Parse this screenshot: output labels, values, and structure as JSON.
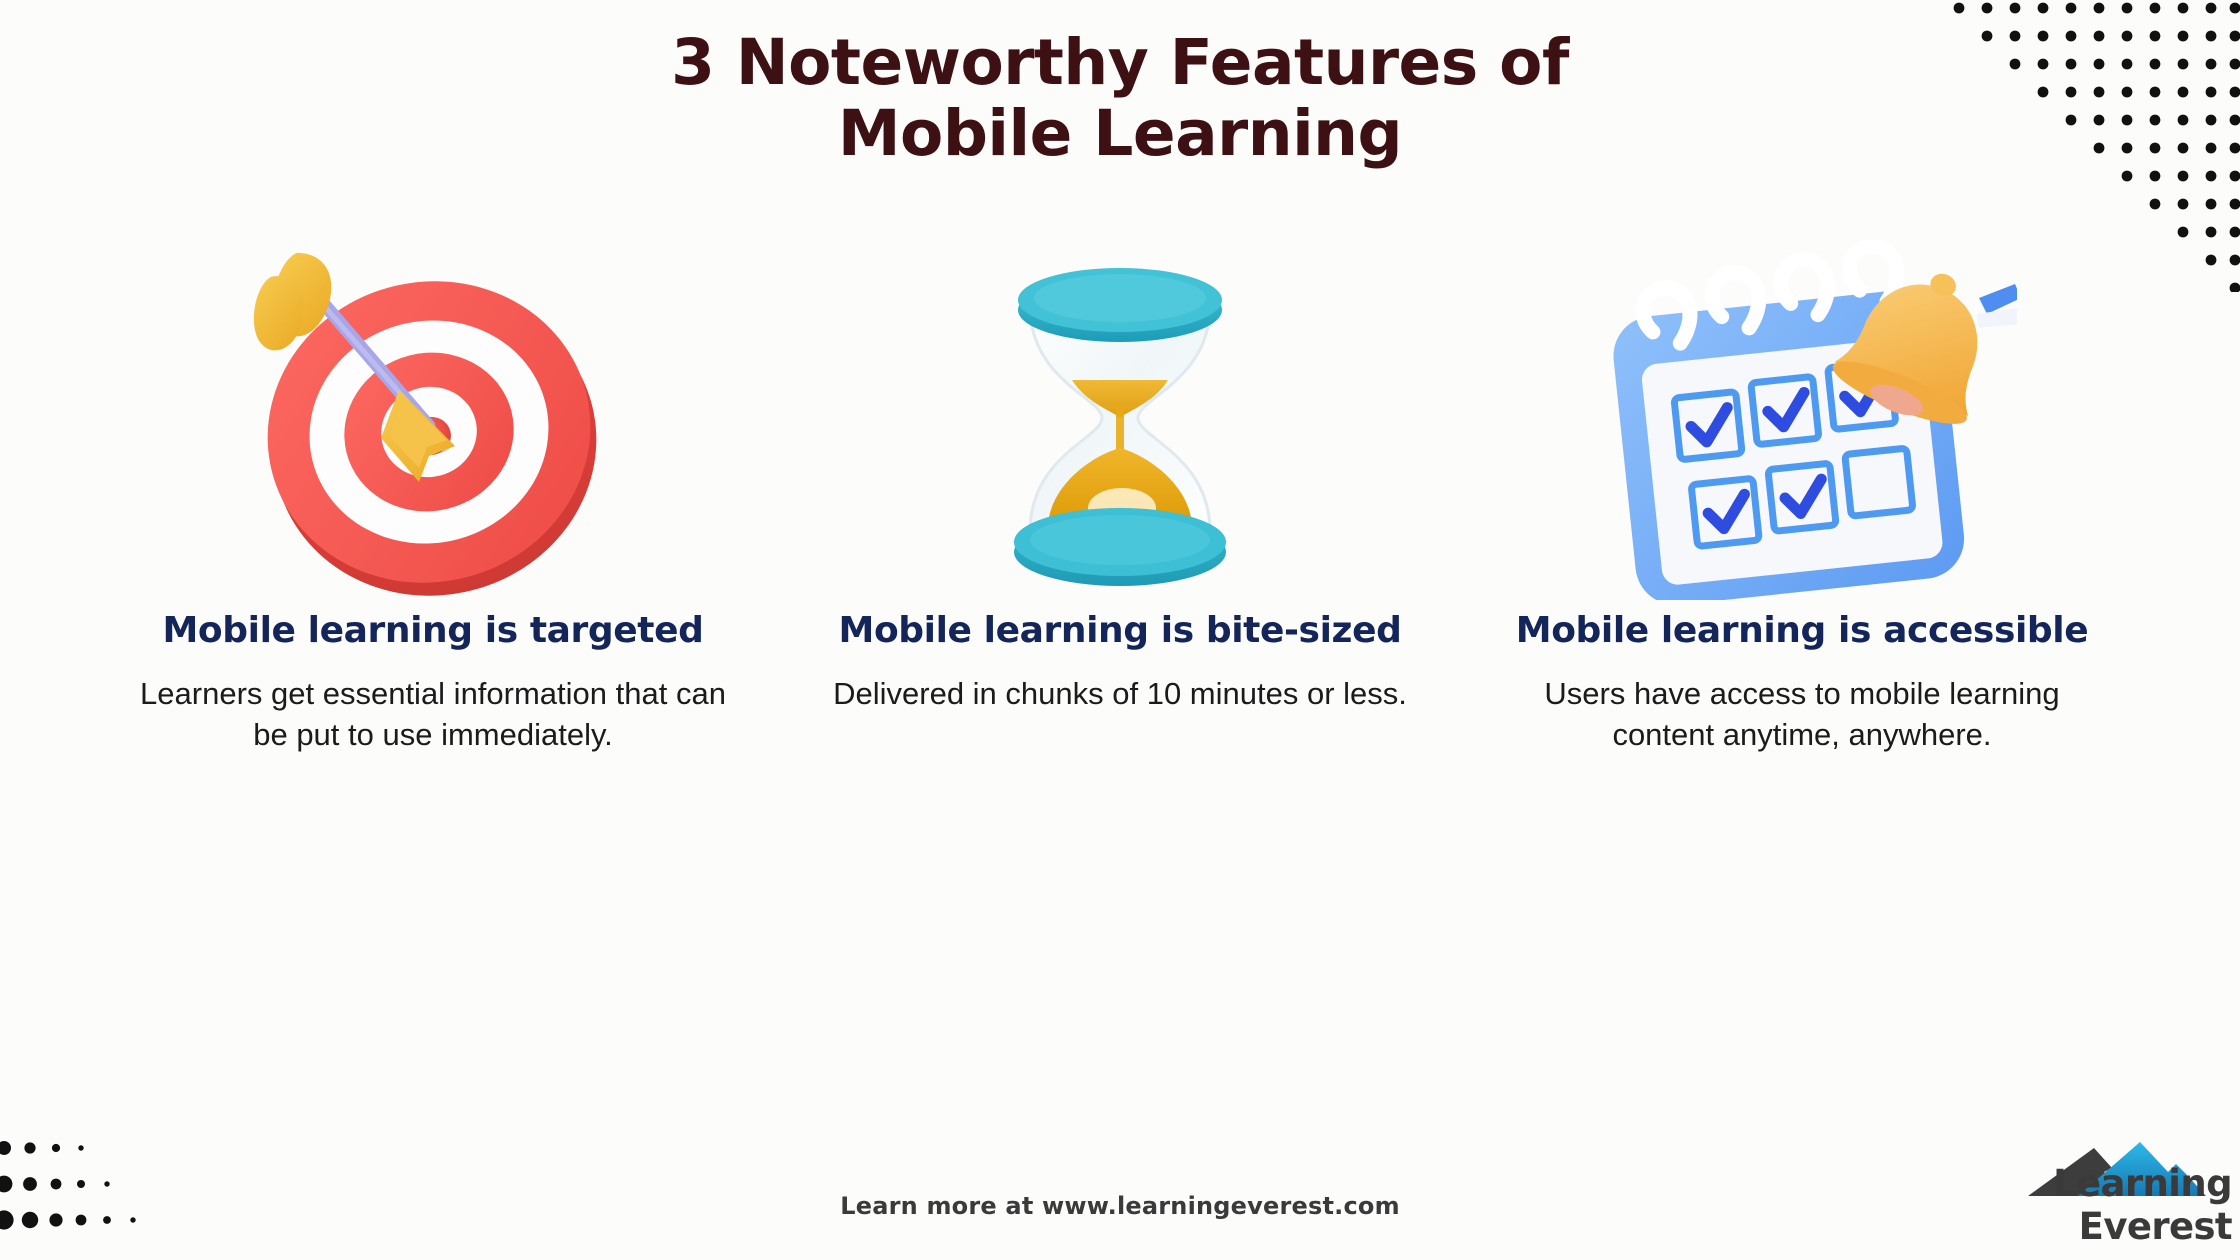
{
  "page": {
    "background_color": "#fcfcfa",
    "title_line1": "3 Noteworthy Features of",
    "title_line2": "Mobile Learning",
    "title_color": "#3d1114"
  },
  "features": [
    {
      "icon": "dartboard-target-with-arrow",
      "heading": "Mobile learning is targeted",
      "body": "Learners get essential information that can be put to use immediately.",
      "heading_color": "#14255a"
    },
    {
      "icon": "hourglass-sand-timer",
      "heading": "Mobile learning is bite-sized",
      "body": "Delivered in chunks of 10 minutes or less.",
      "heading_color": "#14255a"
    },
    {
      "icon": "calendar-checklist-with-bell",
      "heading": "Mobile learning is accessible",
      "body": "Users have access to mobile learning content anytime, anywhere.",
      "heading_color": "#14255a"
    }
  ],
  "footer": {
    "note": "Learn more at www.learningeverest.com",
    "logo_text": "Learning Everest",
    "logo_text_color": "#3a3a3a",
    "logo_peak_dark_color": "#3d3d3d",
    "logo_peak_blue_color": "#1b9fd8"
  },
  "decor": {
    "dots_top_right": "triangular-dot-grid",
    "dots_bottom_left": "graduated-dot-grid",
    "dot_color": "#111111"
  },
  "palette": {
    "target_red": "#f5544f",
    "target_white": "#fdfdfd",
    "arrow_yellow": "#f3b92c",
    "arrow_shaft_purple": "#a9a6e8",
    "hourglass_teal": "#2eaec6",
    "hourglass_sand": "#e8a90f",
    "calendar_blue": "#6aa6f5",
    "calendar_check_blue": "#2f4ce0",
    "bell_orange": "#f7b94a"
  }
}
